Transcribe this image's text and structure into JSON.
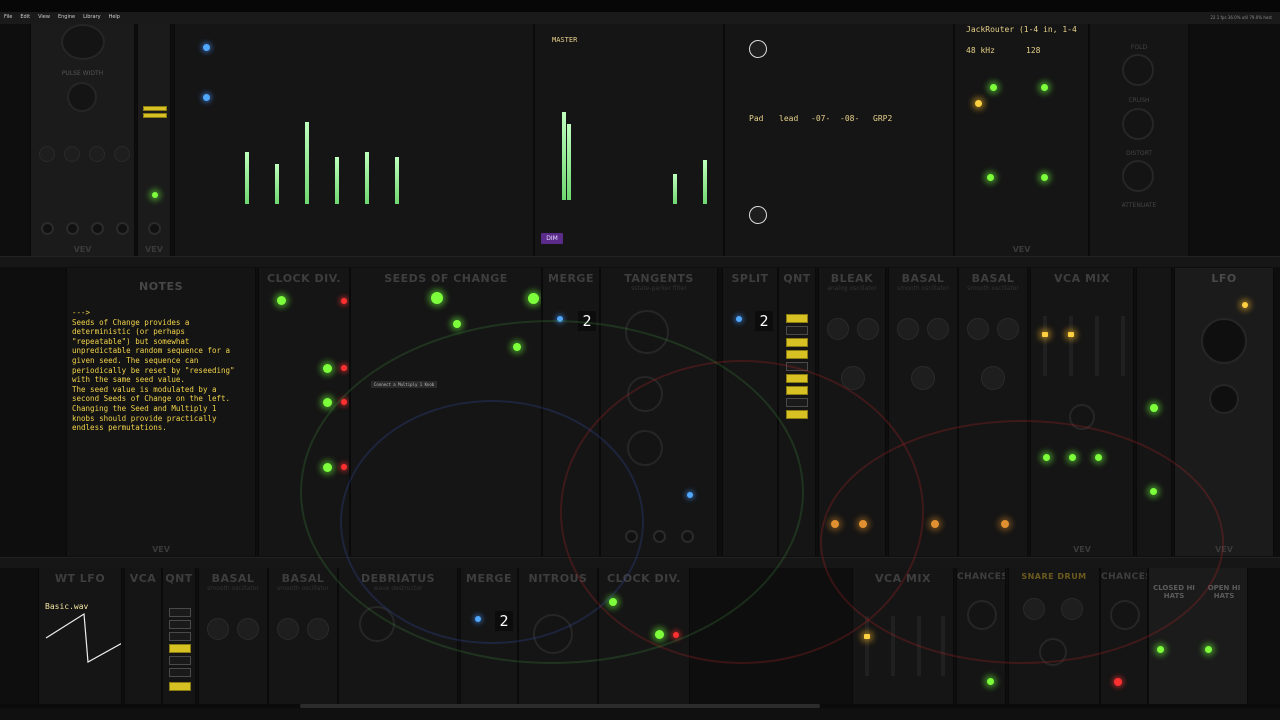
{
  "menu": [
    "File",
    "Edit",
    "View",
    "Engine",
    "Library",
    "Help"
  ],
  "status_text": "22.1 fps  36.0% util  79.0% host",
  "audio": {
    "device": "JackRouter (1-4 in, 1-4",
    "rate": "48 kHz",
    "block": "128"
  },
  "mixer": {
    "master_label": "MASTER",
    "dim_label": "DIM"
  },
  "aux_labels": {
    "a": "Pad",
    "b": "lead",
    "c": "-07-",
    "d": "-08-",
    "e": "GRP2"
  },
  "modules": {
    "notes": "NOTES",
    "clock_div": "CLOCK DIV.",
    "seeds": "SEEDS OF CHANGE",
    "merge": "MERGE",
    "tangents": "TANGENTS",
    "tangents_sub": "sstate-parker filter",
    "split": "SPLIT",
    "qnt": "QNT",
    "bleak": "BLEAK",
    "bleak_sub": "analog oscillator",
    "basal": "BASAL",
    "basal_sub": "smooth oscillator",
    "vca_mix": "VCA MIX",
    "lfo": "LFO",
    "wt_lfo": "WT LFO",
    "vca": "VCA",
    "debriatus": "DEBRIATUS",
    "debriatus_sub": "wave destructor",
    "nitrous": "NITROUS",
    "chances": "CHANCES",
    "snare": "SNARE DRUM",
    "closed_hats": "CLOSED HI HATS",
    "open_hats": "OPEN HI HATS",
    "fold": "FOLD",
    "crush": "CRUSH",
    "distort": "DISTORT",
    "attenuate": "ATTENUATE",
    "vev": "VEV"
  },
  "notes_text": "--->\nSeeds of Change provides a\ndeterministic (or perhaps\n\"repeatable\") but somewhat\nunpredictable random sequence for a\ngiven seed. The sequence can\nperiodically be reset by \"reseeding\"\nwith the same seed value.\nThe seed value is modulated by a\nsecond Seeds of Change on the left.\nChanging the Seed and Multiply 1\nknobs should provide practically\nendless permutations.",
  "merge_display": "2",
  "split_display": "2",
  "merge2_display": "2",
  "wt_file": "Basic.wav",
  "tooltip": "Connect a Multiply 1 Knob",
  "colors": {
    "accent": "#d8c223",
    "led_green": "#7dff3c",
    "notes_text": "#f2d34a",
    "dim_button": "#5b2b8a"
  }
}
